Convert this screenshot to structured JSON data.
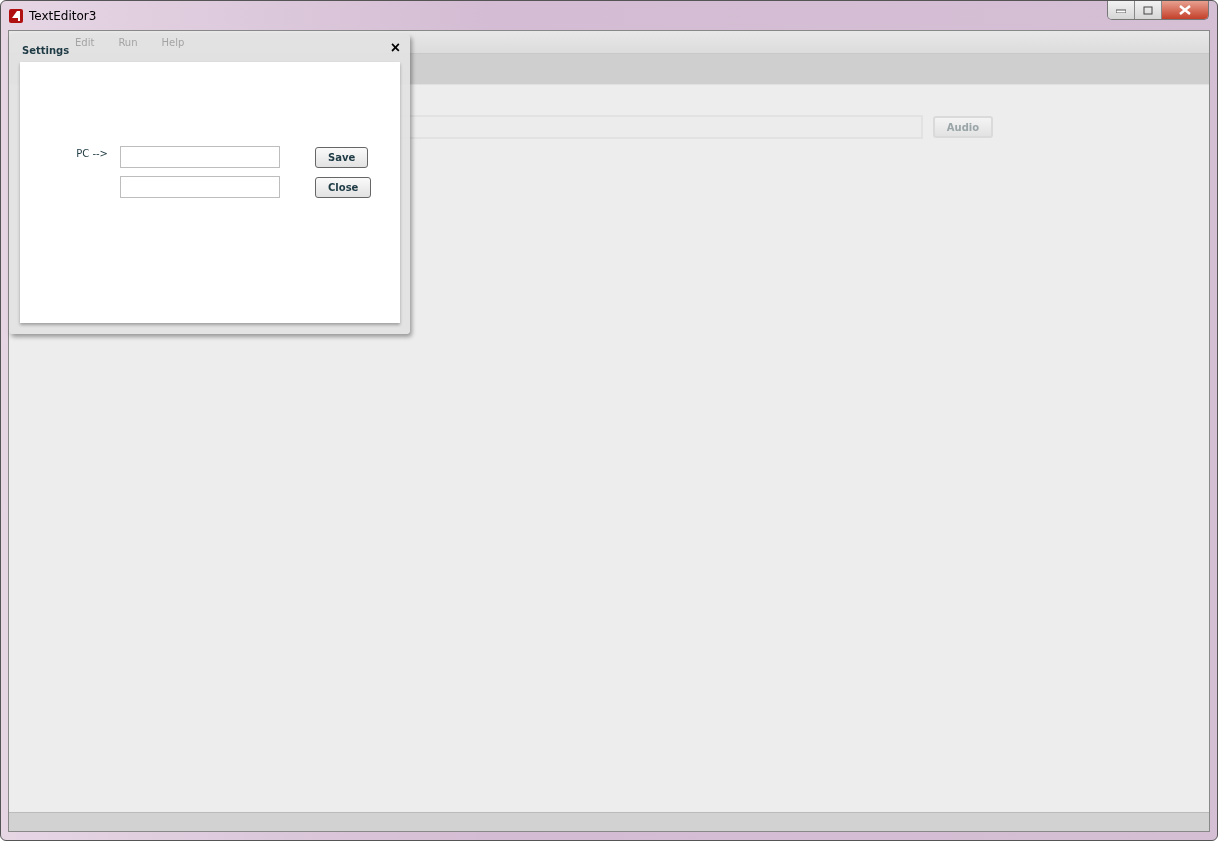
{
  "window": {
    "title": "TextEditor3"
  },
  "menu": [
    "Edit",
    "Run",
    "Help"
  ],
  "toolbar": {
    "button": "Audio"
  },
  "dialog": {
    "title": "Settings",
    "close": "×",
    "label": "PC -->",
    "buttons": [
      "Save",
      "Close"
    ]
  }
}
